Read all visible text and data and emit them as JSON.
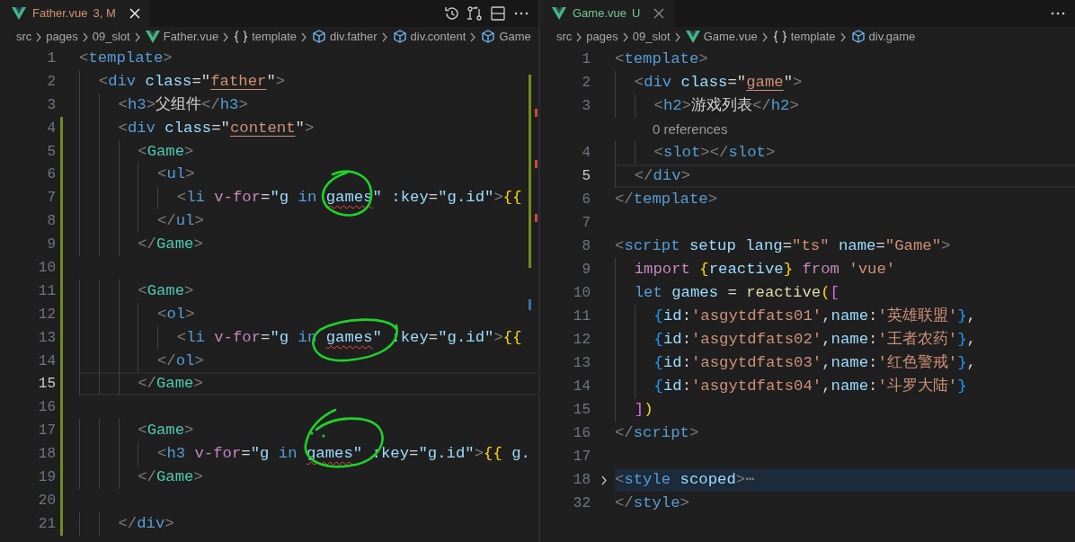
{
  "editors": [
    {
      "tab": {
        "title": "Father.vue",
        "badge": "3, M",
        "color": "#d39072",
        "focused": true
      },
      "toolbar": [
        {
          "kind": "history"
        },
        {
          "kind": "compare"
        },
        {
          "kind": "split"
        },
        {
          "kind": "more"
        }
      ],
      "breadcrumbs": [
        {
          "kind": "folder",
          "label": "src"
        },
        {
          "kind": "folder",
          "label": "pages"
        },
        {
          "kind": "folder",
          "label": "09_slot"
        },
        {
          "kind": "vue",
          "label": "Father.vue"
        },
        {
          "kind": "braces",
          "label": "template"
        },
        {
          "kind": "element",
          "label": "div.father"
        },
        {
          "kind": "element",
          "label": "div.content"
        },
        {
          "kind": "element",
          "label": "Game"
        }
      ],
      "lines": [
        {
          "kind": "code",
          "number": "1",
          "current": false,
          "changed": false,
          "tokens": [
            {
              "text": "<",
              "kind": "punct"
            },
            {
              "text": "template",
              "kind": "tag"
            },
            {
              "text": ">",
              "kind": "punct"
            }
          ]
        },
        {
          "kind": "code",
          "number": "2",
          "current": false,
          "changed": false,
          "tokens": [
            {
              "text": "  <",
              "kind": "punct"
            },
            {
              "text": "div",
              "kind": "tag"
            },
            {
              "text": " class",
              "kind": "attr"
            },
            {
              "text": "=\"",
              "kind": "plain"
            },
            {
              "text": "father",
              "kind": "string",
              "underline": true
            },
            {
              "text": "\"",
              "kind": "plain"
            },
            {
              "text": ">",
              "kind": "punct"
            }
          ]
        },
        {
          "kind": "code",
          "number": "3",
          "current": false,
          "changed": false,
          "tokens": [
            {
              "text": "    <",
              "kind": "punct"
            },
            {
              "text": "h3",
              "kind": "tag"
            },
            {
              "text": ">",
              "kind": "punct"
            },
            {
              "text": "父组件",
              "kind": "plain"
            },
            {
              "text": "</",
              "kind": "punct"
            },
            {
              "text": "h3",
              "kind": "tag"
            },
            {
              "text": ">",
              "kind": "punct"
            }
          ]
        },
        {
          "kind": "code",
          "number": "4",
          "current": false,
          "changed": true,
          "tokens": [
            {
              "text": "    <",
              "kind": "punct"
            },
            {
              "text": "div",
              "kind": "tag"
            },
            {
              "text": " class",
              "kind": "attr"
            },
            {
              "text": "=\"",
              "kind": "plain"
            },
            {
              "text": "content",
              "kind": "string",
              "underline": true
            },
            {
              "text": "\"",
              "kind": "plain"
            },
            {
              "text": ">",
              "kind": "punct"
            }
          ]
        },
        {
          "kind": "code",
          "number": "5",
          "current": false,
          "changed": true,
          "tokens": [
            {
              "text": "      <",
              "kind": "punct"
            },
            {
              "text": "Game",
              "kind": "component"
            },
            {
              "text": ">",
              "kind": "punct"
            }
          ]
        },
        {
          "kind": "code",
          "number": "6",
          "current": false,
          "changed": true,
          "tokens": [
            {
              "text": "        <",
              "kind": "punct"
            },
            {
              "text": "ul",
              "kind": "tag"
            },
            {
              "text": ">",
              "kind": "punct"
            }
          ]
        },
        {
          "kind": "code",
          "number": "7",
          "current": false,
          "changed": true,
          "tokens": [
            {
              "text": "          <",
              "kind": "punct"
            },
            {
              "text": "li",
              "kind": "tag"
            },
            {
              "text": " v-for",
              "kind": "control"
            },
            {
              "text": "=",
              "kind": "plain"
            },
            {
              "text": "\"g ",
              "kind": "attr"
            },
            {
              "text": "in ",
              "kind": "keyword"
            },
            {
              "text": "games",
              "kind": "attr",
              "error": true
            },
            {
              "text": "\"",
              "kind": "attr"
            },
            {
              "text": " :key",
              "kind": "attr"
            },
            {
              "text": "=",
              "kind": "plain"
            },
            {
              "text": "\"g.id\"",
              "kind": "attr"
            },
            {
              "text": ">",
              "kind": "punct"
            },
            {
              "text": "{{",
              "kind": "bracket1"
            }
          ]
        },
        {
          "kind": "code",
          "number": "8",
          "current": false,
          "changed": true,
          "tokens": [
            {
              "text": "        </",
              "kind": "punct"
            },
            {
              "text": "ul",
              "kind": "tag"
            },
            {
              "text": ">",
              "kind": "punct"
            }
          ]
        },
        {
          "kind": "code",
          "number": "9",
          "current": false,
          "changed": true,
          "tokens": [
            {
              "text": "      </",
              "kind": "punct"
            },
            {
              "text": "Game",
              "kind": "component"
            },
            {
              "text": ">",
              "kind": "punct"
            }
          ]
        },
        {
          "kind": "code",
          "number": "10",
          "current": false,
          "changed": true
        },
        {
          "kind": "code",
          "number": "11",
          "current": false,
          "changed": true,
          "tokens": [
            {
              "text": "      <",
              "kind": "punct"
            },
            {
              "text": "Game",
              "kind": "component"
            },
            {
              "text": ">",
              "kind": "punct"
            }
          ]
        },
        {
          "kind": "code",
          "number": "12",
          "current": false,
          "changed": true,
          "tokens": [
            {
              "text": "        <",
              "kind": "punct"
            },
            {
              "text": "ol",
              "kind": "tag"
            },
            {
              "text": ">",
              "kind": "punct"
            }
          ]
        },
        {
          "kind": "code",
          "number": "13",
          "current": false,
          "changed": true,
          "tokens": [
            {
              "text": "          <",
              "kind": "punct"
            },
            {
              "text": "li",
              "kind": "tag"
            },
            {
              "text": " v-for",
              "kind": "control"
            },
            {
              "text": "=",
              "kind": "plain"
            },
            {
              "text": "\"g ",
              "kind": "attr"
            },
            {
              "text": "in ",
              "kind": "keyword"
            },
            {
              "text": "games",
              "kind": "attr",
              "error": true
            },
            {
              "text": "\"",
              "kind": "attr"
            },
            {
              "text": " :key",
              "kind": "attr"
            },
            {
              "text": "=",
              "kind": "plain"
            },
            {
              "text": "\"g.id\"",
              "kind": "attr"
            },
            {
              "text": ">",
              "kind": "punct"
            },
            {
              "text": "{{",
              "kind": "bracket1"
            }
          ]
        },
        {
          "kind": "code",
          "number": "14",
          "current": false,
          "changed": true,
          "tokens": [
            {
              "text": "        </",
              "kind": "punct"
            },
            {
              "text": "ol",
              "kind": "tag"
            },
            {
              "text": ">",
              "kind": "punct"
            }
          ]
        },
        {
          "kind": "code",
          "number": "15",
          "current": true,
          "changed": true,
          "tokens": [
            {
              "text": "      </",
              "kind": "punct"
            },
            {
              "text": "Game",
              "kind": "component"
            },
            {
              "text": ">",
              "kind": "punct"
            }
          ]
        },
        {
          "kind": "code",
          "number": "16",
          "current": false,
          "changed": true
        },
        {
          "kind": "code",
          "number": "17",
          "current": false,
          "changed": true,
          "tokens": [
            {
              "text": "      <",
              "kind": "punct"
            },
            {
              "text": "Game",
              "kind": "component"
            },
            {
              "text": ">",
              "kind": "punct"
            }
          ]
        },
        {
          "kind": "code",
          "number": "18",
          "current": false,
          "changed": true,
          "tokens": [
            {
              "text": "        <",
              "kind": "punct"
            },
            {
              "text": "h3",
              "kind": "tag"
            },
            {
              "text": " v-for",
              "kind": "control"
            },
            {
              "text": "=",
              "kind": "plain"
            },
            {
              "text": "\"g ",
              "kind": "attr"
            },
            {
              "text": "in ",
              "kind": "keyword"
            },
            {
              "text": "games",
              "kind": "attr",
              "error": true
            },
            {
              "text": "\"",
              "kind": "attr"
            },
            {
              "text": " :key",
              "kind": "attr"
            },
            {
              "text": "=",
              "kind": "plain"
            },
            {
              "text": "\"g.id\"",
              "kind": "attr"
            },
            {
              "text": ">",
              "kind": "punct"
            },
            {
              "text": "{{",
              "kind": "bracket1"
            },
            {
              "text": " g.",
              "kind": "attr"
            }
          ]
        },
        {
          "kind": "code",
          "number": "19",
          "current": false,
          "changed": true,
          "tokens": [
            {
              "text": "      </",
              "kind": "punct"
            },
            {
              "text": "Game",
              "kind": "component"
            },
            {
              "text": ">",
              "kind": "punct"
            }
          ]
        },
        {
          "kind": "code",
          "number": "20",
          "current": false,
          "changed": true
        },
        {
          "kind": "code",
          "number": "21",
          "current": false,
          "changed": true,
          "tokens": [
            {
              "text": "    </",
              "kind": "punct"
            },
            {
              "text": "div",
              "kind": "tag"
            },
            {
              "text": ">",
              "kind": "punct"
            }
          ]
        }
      ]
    },
    {
      "tab": {
        "title": "Game.vue",
        "badge": "U",
        "color": "#73c991",
        "focused": false
      },
      "toolbar": [
        {
          "kind": "more"
        }
      ],
      "breadcrumbs": [
        {
          "kind": "folder",
          "label": "src"
        },
        {
          "kind": "folder",
          "label": "pages"
        },
        {
          "kind": "folder",
          "label": "09_slot"
        },
        {
          "kind": "vue",
          "label": "Game.vue"
        },
        {
          "kind": "braces",
          "label": "template"
        },
        {
          "kind": "element",
          "label": "div.game"
        }
      ],
      "lines": [
        {
          "kind": "code",
          "number": "1",
          "current": false,
          "folded": false,
          "tokens": [
            {
              "text": "<",
              "kind": "punct"
            },
            {
              "text": "template",
              "kind": "tag"
            },
            {
              "text": ">",
              "kind": "punct"
            }
          ]
        },
        {
          "kind": "code",
          "number": "2",
          "current": false,
          "folded": false,
          "tokens": [
            {
              "text": "  <",
              "kind": "punct"
            },
            {
              "text": "div",
              "kind": "tag"
            },
            {
              "text": " class",
              "kind": "attr"
            },
            {
              "text": "=\"",
              "kind": "plain"
            },
            {
              "text": "game",
              "kind": "string",
              "underline": true
            },
            {
              "text": "\"",
              "kind": "plain"
            },
            {
              "text": ">",
              "kind": "punct"
            }
          ]
        },
        {
          "kind": "code",
          "number": "3",
          "current": false,
          "folded": false,
          "tokens": [
            {
              "text": "    <",
              "kind": "punct"
            },
            {
              "text": "h2",
              "kind": "tag"
            },
            {
              "text": ">",
              "kind": "punct"
            },
            {
              "text": "游戏列表",
              "kind": "plain"
            },
            {
              "text": "</",
              "kind": "punct"
            },
            {
              "text": "h2",
              "kind": "tag"
            },
            {
              "text": ">",
              "kind": "punct"
            }
          ]
        },
        {
          "kind": "codelens",
          "text": "0 references"
        },
        {
          "kind": "code",
          "number": "4",
          "current": false,
          "folded": false,
          "tokens": [
            {
              "text": "    <",
              "kind": "punct"
            },
            {
              "text": "slot",
              "kind": "tag"
            },
            {
              "text": "></",
              "kind": "punct"
            },
            {
              "text": "slot",
              "kind": "tag"
            },
            {
              "text": ">",
              "kind": "punct"
            }
          ]
        },
        {
          "kind": "code",
          "number": "5",
          "current": true,
          "folded": false,
          "tokens": [
            {
              "text": "  </",
              "kind": "punct"
            },
            {
              "text": "div",
              "kind": "tag"
            },
            {
              "text": ">",
              "kind": "punct"
            }
          ]
        },
        {
          "kind": "code",
          "number": "6",
          "current": false,
          "folded": false,
          "tokens": [
            {
              "text": "</",
              "kind": "punct"
            },
            {
              "text": "template",
              "kind": "tag"
            },
            {
              "text": ">",
              "kind": "punct"
            }
          ]
        },
        {
          "kind": "code",
          "number": "7",
          "current": false,
          "folded": false
        },
        {
          "kind": "code",
          "number": "8",
          "current": false,
          "folded": false,
          "tokens": [
            {
              "text": "<",
              "kind": "punct"
            },
            {
              "text": "script",
              "kind": "tag"
            },
            {
              "text": " setup",
              "kind": "attr"
            },
            {
              "text": " lang",
              "kind": "attr"
            },
            {
              "text": "=",
              "kind": "plain"
            },
            {
              "text": "\"ts\"",
              "kind": "string"
            },
            {
              "text": " name",
              "kind": "attr"
            },
            {
              "text": "=",
              "kind": "plain"
            },
            {
              "text": "\"Game\"",
              "kind": "string"
            },
            {
              "text": ">",
              "kind": "punct"
            }
          ]
        },
        {
          "kind": "code",
          "number": "9",
          "current": false,
          "folded": false,
          "tokens": [
            {
              "text": "  import ",
              "kind": "control"
            },
            {
              "text": "{",
              "kind": "bracket1"
            },
            {
              "text": "reactive",
              "kind": "attr"
            },
            {
              "text": "}",
              "kind": "bracket1"
            },
            {
              "text": " from ",
              "kind": "control"
            },
            {
              "text": "'vue'",
              "kind": "string"
            }
          ]
        },
        {
          "kind": "code",
          "number": "10",
          "current": false,
          "folded": false,
          "tokens": [
            {
              "text": "  let ",
              "kind": "keyword"
            },
            {
              "text": "games",
              "kind": "attr"
            },
            {
              "text": " = ",
              "kind": "plain"
            },
            {
              "text": "reactive",
              "kind": "function"
            },
            {
              "text": "(",
              "kind": "bracket1"
            },
            {
              "text": "[",
              "kind": "bracket2"
            }
          ]
        },
        {
          "kind": "code",
          "number": "11",
          "current": false,
          "folded": false,
          "tokens": [
            {
              "text": "    {",
              "kind": "bracket3"
            },
            {
              "text": "id",
              "kind": "attr"
            },
            {
              "text": ":",
              "kind": "plain"
            },
            {
              "text": "'asgytdfats01'",
              "kind": "string"
            },
            {
              "text": ",",
              "kind": "plain"
            },
            {
              "text": "name",
              "kind": "attr"
            },
            {
              "text": ":",
              "kind": "plain"
            },
            {
              "text": "'英雄联盟'",
              "kind": "string"
            },
            {
              "text": "}",
              "kind": "bracket3"
            },
            {
              "text": ",",
              "kind": "plain"
            }
          ]
        },
        {
          "kind": "code",
          "number": "12",
          "current": false,
          "folded": false,
          "tokens": [
            {
              "text": "    {",
              "kind": "bracket3"
            },
            {
              "text": "id",
              "kind": "attr"
            },
            {
              "text": ":",
              "kind": "plain"
            },
            {
              "text": "'asgytdfats02'",
              "kind": "string"
            },
            {
              "text": ",",
              "kind": "plain"
            },
            {
              "text": "name",
              "kind": "attr"
            },
            {
              "text": ":",
              "kind": "plain"
            },
            {
              "text": "'王者农药'",
              "kind": "string"
            },
            {
              "text": "}",
              "kind": "bracket3"
            },
            {
              "text": ",",
              "kind": "plain"
            }
          ]
        },
        {
          "kind": "code",
          "number": "13",
          "current": false,
          "folded": false,
          "tokens": [
            {
              "text": "    {",
              "kind": "bracket3"
            },
            {
              "text": "id",
              "kind": "attr"
            },
            {
              "text": ":",
              "kind": "plain"
            },
            {
              "text": "'asgytdfats03'",
              "kind": "string"
            },
            {
              "text": ",",
              "kind": "plain"
            },
            {
              "text": "name",
              "kind": "attr"
            },
            {
              "text": ":",
              "kind": "plain"
            },
            {
              "text": "'红色警戒'",
              "kind": "string"
            },
            {
              "text": "}",
              "kind": "bracket3"
            },
            {
              "text": ",",
              "kind": "plain"
            }
          ]
        },
        {
          "kind": "code",
          "number": "14",
          "current": false,
          "folded": false,
          "tokens": [
            {
              "text": "    {",
              "kind": "bracket3"
            },
            {
              "text": "id",
              "kind": "attr"
            },
            {
              "text": ":",
              "kind": "plain"
            },
            {
              "text": "'asgytdfats04'",
              "kind": "string"
            },
            {
              "text": ",",
              "kind": "plain"
            },
            {
              "text": "name",
              "kind": "attr"
            },
            {
              "text": ":",
              "kind": "plain"
            },
            {
              "text": "'斗罗大陆'",
              "kind": "string"
            },
            {
              "text": "}",
              "kind": "bracket3"
            }
          ]
        },
        {
          "kind": "code",
          "number": "15",
          "current": false,
          "folded": false,
          "tokens": [
            {
              "text": "  ]",
              "kind": "bracket2"
            },
            {
              "text": ")",
              "kind": "bracket1"
            }
          ]
        },
        {
          "kind": "code",
          "number": "16",
          "current": false,
          "folded": false,
          "tokens": [
            {
              "text": "</",
              "kind": "punct"
            },
            {
              "text": "script",
              "kind": "tag"
            },
            {
              "text": ">",
              "kind": "punct"
            }
          ]
        },
        {
          "kind": "code",
          "number": "17",
          "current": false,
          "folded": false
        },
        {
          "kind": "code",
          "number": "18",
          "current": false,
          "folded": true,
          "tokens": [
            {
              "text": "<",
              "kind": "punct"
            },
            {
              "text": "style",
              "kind": "tag"
            },
            {
              "text": " scoped",
              "kind": "attr"
            },
            {
              "text": ">",
              "kind": "punct"
            },
            {
              "text": "⋯",
              "kind": "punct"
            }
          ]
        },
        {
          "kind": "code",
          "number": "32",
          "current": false,
          "folded": false,
          "tokens": [
            {
              "text": "</",
              "kind": "punct"
            },
            {
              "text": "style",
              "kind": "tag"
            },
            {
              "text": ">",
              "kind": "punct"
            }
          ]
        }
      ]
    }
  ]
}
